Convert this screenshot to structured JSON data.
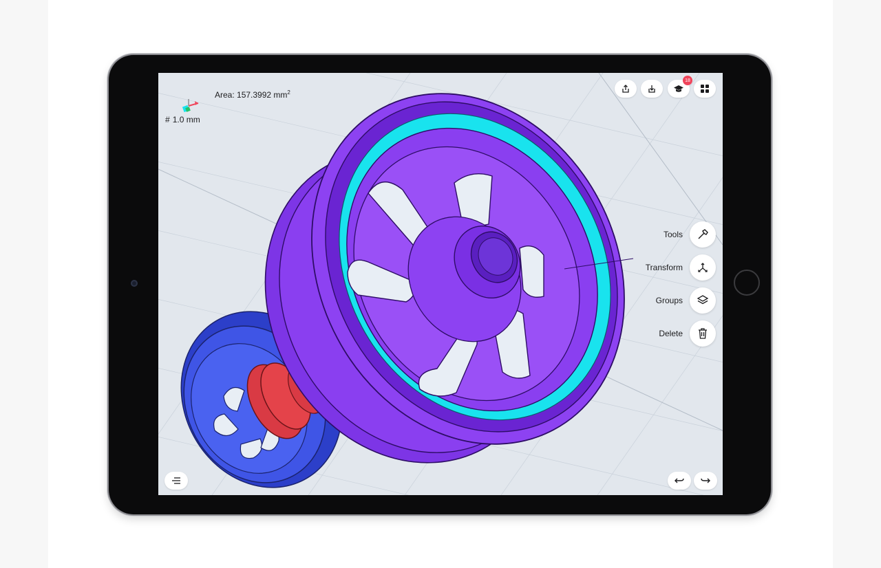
{
  "hud": {
    "area_text": "Area: 157.3992 mm",
    "area_unit_sup": "2",
    "grid_symbol": "#",
    "grid_text": "1.0 mm"
  },
  "top_bar": {
    "export_icon": "share-up-icon",
    "import_icon": "download-icon",
    "learn_icon": "graduation-cap-icon",
    "learn_badge": "18",
    "apps_icon": "grid-icon"
  },
  "side_menu": [
    {
      "label": "Tools",
      "icon": "hammer-icon"
    },
    {
      "label": "Transform",
      "icon": "transform-arrows-icon"
    },
    {
      "label": "Groups",
      "icon": "layers-icon"
    },
    {
      "label": "Delete",
      "icon": "trash-icon"
    }
  ],
  "bottom_bar": {
    "menu_icon": "list-menu-icon",
    "undo_icon": "undo-icon",
    "redo_icon": "redo-icon"
  },
  "colors": {
    "wheel_large": "#8a3ff0",
    "wheel_large_dark": "#5e1fc4",
    "wheel_small": "#3f55e6",
    "axle": "#e4434a",
    "highlight": "#19e3ee",
    "badge": "#f0445a"
  }
}
